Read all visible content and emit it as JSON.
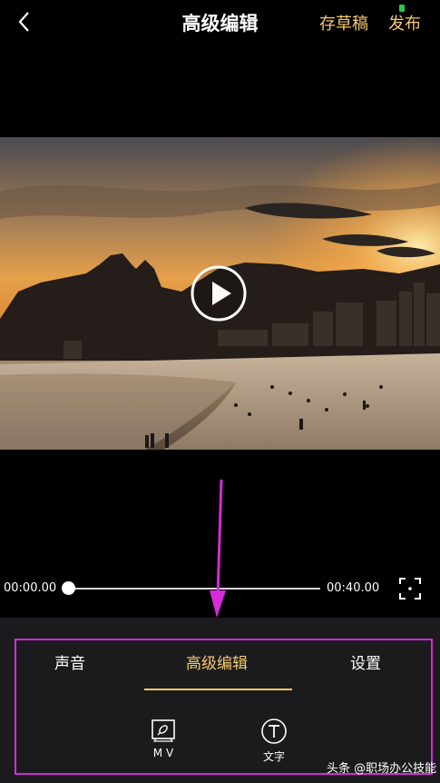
{
  "header": {
    "title": "高级编辑",
    "save_draft_label": "存草稿",
    "publish_label": "发布"
  },
  "player": {
    "current_time": "00:00.00",
    "total_time": "00:40.00",
    "progress": 0
  },
  "tabs": [
    {
      "label": "声音"
    },
    {
      "label": "高级编辑",
      "active": true
    },
    {
      "label": "设置"
    }
  ],
  "tools": [
    {
      "label": "M V",
      "icon": "mv-icon"
    },
    {
      "label": "文字",
      "icon": "text-icon"
    }
  ],
  "watermark": "头条 @职场办公技能",
  "colors": {
    "accent": "#f5c96a",
    "annotation": "#d52bd8",
    "background": "#000000",
    "panel": "#1b1b1d"
  }
}
